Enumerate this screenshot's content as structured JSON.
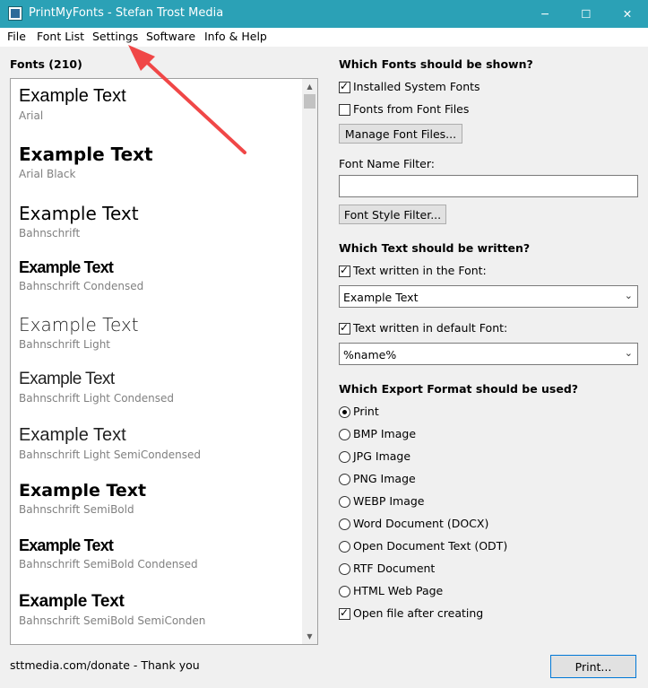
{
  "window": {
    "title": "PrintMyFonts - Stefan Trost Media",
    "minimize": "─",
    "maximize": "☐",
    "close": "✕"
  },
  "menu": [
    "File",
    "Font List",
    "Settings",
    "Software",
    "Info & Help"
  ],
  "fonts_header": "Fonts (210)",
  "font_entries": [
    {
      "sample": "Example Text",
      "name": "Arial"
    },
    {
      "sample": "Example Text",
      "name": "Arial Black"
    },
    {
      "sample": "Example Text",
      "name": "Bahnschrift"
    },
    {
      "sample": "Example Text",
      "name": "Bahnschrift Condensed"
    },
    {
      "sample": "Example Text",
      "name": "Bahnschrift Light"
    },
    {
      "sample": "Example Text",
      "name": "Bahnschrift Light Condensed"
    },
    {
      "sample": "Example Text",
      "name": "Bahnschrift Light SemiCondensed"
    },
    {
      "sample": "Example Text",
      "name": "Bahnschrift SemiBold"
    },
    {
      "sample": "Example Text",
      "name": "Bahnschrift SemiBold Condensed"
    },
    {
      "sample": "Example Text",
      "name": "Bahnschrift SemiBold SemiConden"
    }
  ],
  "section_fonts": {
    "heading": "Which Fonts should be shown?",
    "installed_label": "Installed System Fonts",
    "installed_checked": true,
    "from_files_label": "Fonts from Font Files",
    "from_files_checked": false,
    "manage_button": "Manage Font Files...",
    "filter_label": "Font Name Filter:",
    "filter_value": "",
    "style_filter_button": "Font Style Filter..."
  },
  "section_text": {
    "heading": "Which Text should be written?",
    "in_font_label": "Text written in the Font:",
    "in_font_checked": true,
    "in_font_value": "Example Text",
    "default_font_label": "Text written in default Font:",
    "default_font_checked": true,
    "default_font_value": "%name%"
  },
  "section_export": {
    "heading": "Which Export Format should be used?",
    "options": [
      "Print",
      "BMP Image",
      "JPG Image",
      "PNG Image",
      "WEBP Image",
      "Word Document (DOCX)",
      "Open Document Text (ODT)",
      "RTF Document",
      "HTML Web Page"
    ],
    "selected": "Print",
    "open_after_label": "Open file after creating",
    "open_after_checked": true
  },
  "footer": {
    "donate_text": "sttmedia.com/donate - Thank you",
    "print_button": "Print..."
  },
  "colors": {
    "titlebar": "#2ba1b6",
    "annotation_arrow": "#f04747"
  }
}
